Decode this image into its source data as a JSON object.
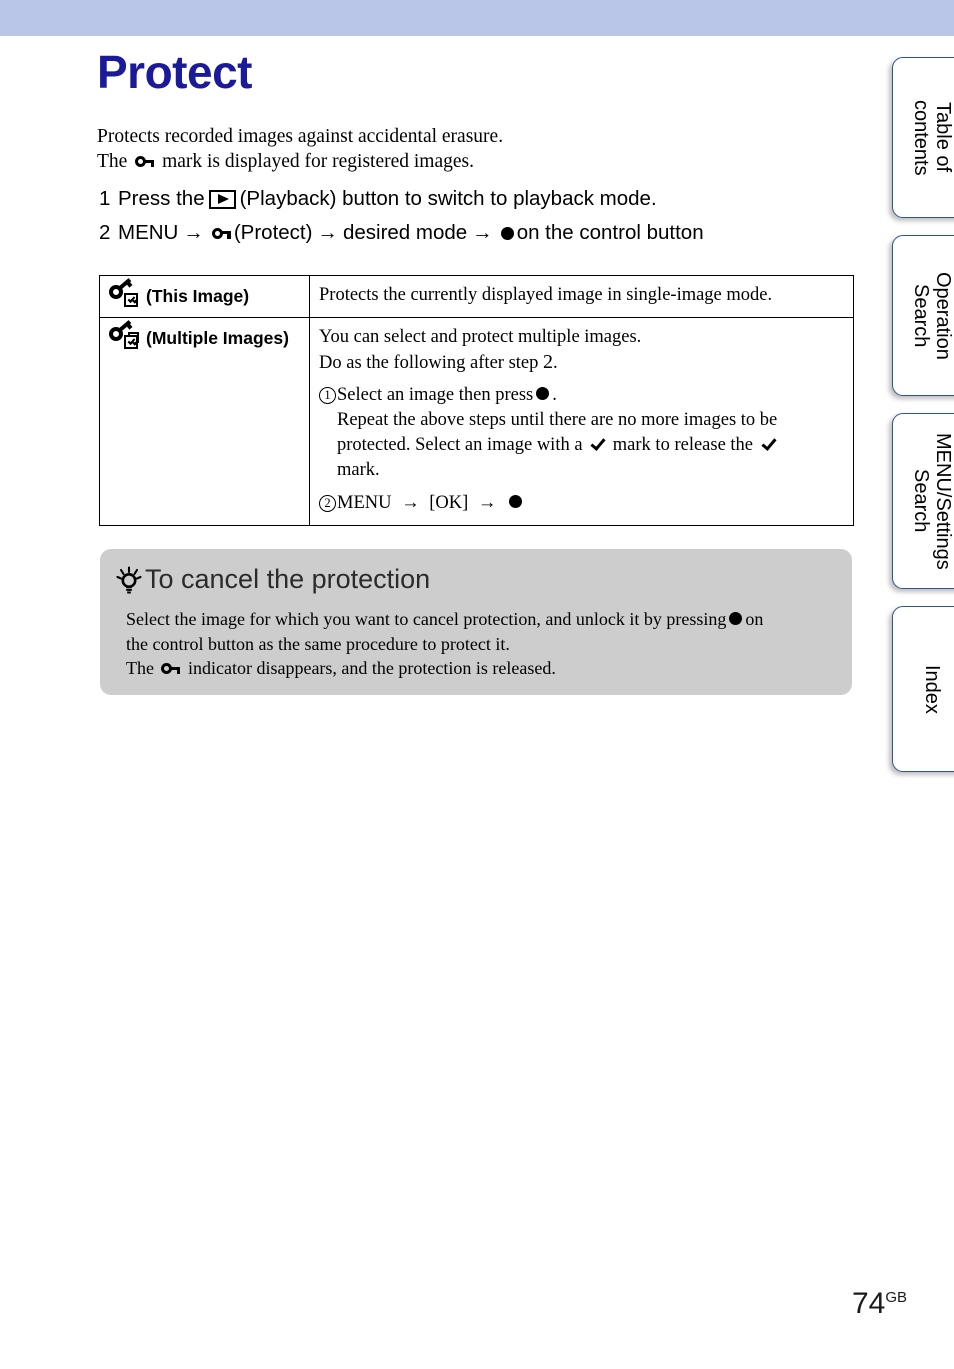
{
  "banner": {
    "color": "#b9c6e8"
  },
  "page": {
    "title": "Protect",
    "title_color": "#1b1b99",
    "intro_line1": "Protects recorded images against accidental erasure.",
    "intro_line2_before": "The",
    "intro_line2_after": "mark is displayed for registered images.",
    "number": "74",
    "number_suffix": "GB"
  },
  "steps": [
    {
      "num": "1",
      "part1": "Press the",
      "icon": "playback-icon",
      "part2": "(Playback) button to switch to playback mode."
    },
    {
      "num": "2",
      "menu": "MENU",
      "arrow1": "→",
      "key_icon": "key-icon",
      "protect_label": "(Protect)",
      "arrow2": "→",
      "desired_mode": "desired mode",
      "arrow3": "→",
      "dot_icon": "control-dot-icon",
      "tail": "on the control button"
    }
  ],
  "table": {
    "rows": [
      {
        "icon": "key-checkbox-single-icon",
        "label": "(This Image)",
        "desc_lines": [
          "Protects the currently displayed image in single-image mode."
        ]
      },
      {
        "icon": "key-checkbox-multiple-icon",
        "label": "(Multiple Images)",
        "desc_line1": "You can select and protect multiple images.",
        "desc_line2_a": "Do as the following after step",
        "desc_line2_b": "2",
        "desc_line2_c": ".",
        "item1_num": "1",
        "item1_text_a": "Select an image then press",
        "item1_text_b": ".",
        "item1_sub_a": "Repeat the above steps until there are no more images to be",
        "item1_sub_b": "protected. Select an image with a",
        "item1_sub_c": "mark to release the",
        "item1_sub_d": "mark.",
        "item2_num": "2",
        "item2_menu": "MENU",
        "item2_arrow1": "→",
        "item2_ok": "[OK]",
        "item2_arrow2": "→"
      }
    ]
  },
  "tip": {
    "icon": "lightbulb-icon",
    "heading": "To cancel the protection",
    "line1": "Select the image for which you want to cancel protection, and unlock it by pressing",
    "line1_tail": "on",
    "line2": "the control button as the same procedure to protect it.",
    "line3_before": "The",
    "line3_after": "indicator disappears, and the protection is released."
  },
  "side_tabs": [
    {
      "label": "Table of\ncontents"
    },
    {
      "label": "Operation\nSearch"
    },
    {
      "label": "MENU/Settings\nSearch"
    },
    {
      "label": "Index"
    }
  ]
}
